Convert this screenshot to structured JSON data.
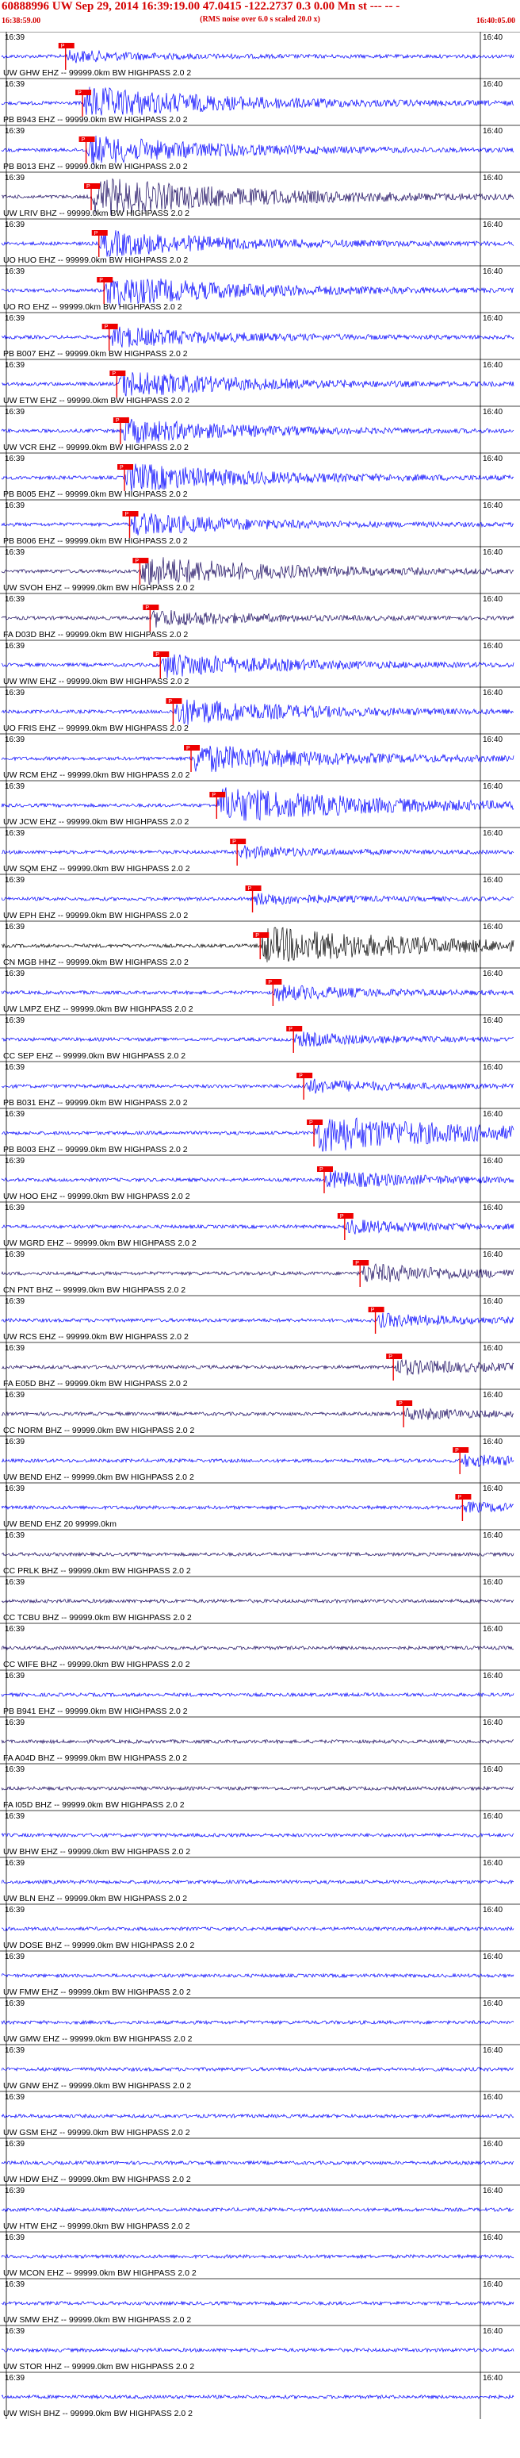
{
  "header": {
    "title": "60888996 UW Sep 29, 2014 16:39:19.00   47.0415 -122.2737  0.3 0.00 Mn st --- -- -",
    "subtitle": "(RMS noise over 6.0 s scaled 20.0 x)",
    "start_time": "16:38:59.00",
    "end_time": "16:40:05.00"
  },
  "colors": {
    "header_red": "#d40000",
    "trace_blue": "#0000ff",
    "trace_dark": "#1a0a60",
    "trace_black": "#000000",
    "pick_red": "#ee0000",
    "pick_label": "P"
  },
  "chart_data": {
    "type": "seismogram",
    "time_start": "16:38:59.00",
    "time_end": "16:40:05.00",
    "tick_left": "16:39",
    "tick_right": "16:40",
    "channels": [
      {
        "label": "UW GHW EHZ -- 99999.0km BW  HIGHPASS  2.0  2",
        "color": "blue",
        "pick": 0.125,
        "amp": 0.3
      },
      {
        "label": "PB B943 EHZ -- 99999.0km BW  HIGHPASS  2.0  2",
        "color": "blue",
        "pick": 0.158,
        "amp": 0.85
      },
      {
        "label": "PB B013 EHZ -- 99999.0km BW  HIGHPASS  2.0  2",
        "color": "blue",
        "pick": 0.165,
        "amp": 0.75
      },
      {
        "label": "UW LRIV BHZ -- 99999.0km BW  HIGHPASS  2.0  2",
        "color": "dark",
        "pick": 0.175,
        "amp": 1.0
      },
      {
        "label": "UO HUO EHZ -- 99999.0km BW  HIGHPASS  2.0  2",
        "color": "blue",
        "pick": 0.19,
        "amp": 0.7
      },
      {
        "label": "UO RO EHZ -- 99999.0km BW  HIGHPASS  2.0  2",
        "color": "blue",
        "pick": 0.2,
        "amp": 0.8
      },
      {
        "label": "PB B007 EHZ -- 99999.0km BW  HIGHPASS  2.0  2",
        "color": "blue",
        "pick": 0.21,
        "amp": 0.55
      },
      {
        "label": "UW ETW EHZ -- 99999.0km BW  HIGHPASS  2.0  2",
        "color": "blue",
        "pick": 0.225,
        "amp": 0.7
      },
      {
        "label": "UW VCR EHZ -- 99999.0km BW  HIGHPASS  2.0  2",
        "color": "blue",
        "pick": 0.232,
        "amp": 0.65
      },
      {
        "label": "PB B005 EHZ -- 99999.0km BW  HIGHPASS  2.0  2",
        "color": "blue",
        "pick": 0.24,
        "amp": 0.75
      },
      {
        "label": "PB B006 EHZ -- 99999.0km BW  HIGHPASS  2.0  2",
        "color": "blue",
        "pick": 0.25,
        "amp": 0.6
      },
      {
        "label": "UW SVOH EHZ -- 99999.0km BW  HIGHPASS  2.0  2",
        "color": "dark",
        "pick": 0.27,
        "amp": 0.8
      },
      {
        "label": "FA D03D BHZ -- 99999.0km BW  HIGHPASS  2.0  2",
        "color": "dark",
        "pick": 0.29,
        "amp": 0.45
      },
      {
        "label": "UW WIW EHZ -- 99999.0km BW  HIGHPASS  2.0  2",
        "color": "blue",
        "pick": 0.31,
        "amp": 0.65
      },
      {
        "label": "UO FRIS EHZ -- 99999.0km BW  HIGHPASS  2.0  2",
        "color": "blue",
        "pick": 0.335,
        "amp": 0.7
      },
      {
        "label": "UW RCM EHZ -- 99999.0km BW  HIGHPASS  2.0  2",
        "color": "blue",
        "pick": 0.37,
        "amp": 0.75
      },
      {
        "label": "UW JCW EHZ -- 99999.0km BW  HIGHPASS  2.0  2",
        "color": "blue",
        "pick": 0.42,
        "amp": 0.95
      },
      {
        "label": "UW SQM EHZ -- 99999.0km BW  HIGHPASS  2.0  2",
        "color": "blue",
        "pick": 0.46,
        "amp": 0.3
      },
      {
        "label": "UW EPH EHZ -- 99999.0km BW  HIGHPASS  2.0  2",
        "color": "blue",
        "pick": 0.49,
        "amp": 0.3
      },
      {
        "label": "CN MGB HHZ -- 99999.0km BW  HIGHPASS  2.0  2",
        "color": "black",
        "pick": 0.505,
        "amp": 1.0
      },
      {
        "label": "UW LMPZ EHZ -- 99999.0km BW  HIGHPASS  2.0  2",
        "color": "blue",
        "pick": 0.53,
        "amp": 0.4
      },
      {
        "label": "CC SEP EHZ -- 99999.0km BW  HIGHPASS  2.0  2",
        "color": "blue",
        "pick": 0.57,
        "amp": 0.35
      },
      {
        "label": "PB B031 EHZ -- 99999.0km BW  HIGHPASS  2.0  2",
        "color": "blue",
        "pick": 0.59,
        "amp": 0.35
      },
      {
        "label": "PB B003 EHZ -- 99999.0km BW  HIGHPASS  2.0  2",
        "color": "blue",
        "pick": 0.61,
        "amp": 1.0
      },
      {
        "label": "UW HOO EHZ -- 99999.0km BW  HIGHPASS  2.0  2",
        "color": "blue",
        "pick": 0.63,
        "amp": 0.45
      },
      {
        "label": "UW MGRD EHZ -- 99999.0km BW  HIGHPASS  2.0  2",
        "color": "blue",
        "pick": 0.67,
        "amp": 0.35
      },
      {
        "label": "CN PNT BHZ -- 99999.0km BW  HIGHPASS  2.0  2",
        "color": "dark",
        "pick": 0.7,
        "amp": 0.5
      },
      {
        "label": "UW RCS EHZ -- 99999.0km BW  HIGHPASS  2.0  2",
        "color": "blue",
        "pick": 0.73,
        "amp": 0.35
      },
      {
        "label": "FA E05D BHZ -- 99999.0km BW  HIGHPASS  2.0  2",
        "color": "dark",
        "pick": 0.765,
        "amp": 0.4
      },
      {
        "label": "CC NORM BHZ -- 99999.0km BW  HIGHPASS  2.0  2",
        "color": "dark",
        "pick": 0.785,
        "amp": 0.3
      },
      {
        "label": "UW BEND EHZ -- 99999.0km BW  HIGHPASS  2.0  2",
        "color": "blue",
        "pick": 0.895,
        "amp": 0.3
      },
      {
        "label": "UW BEND EHZ 20 99999.0km",
        "color": "blue",
        "pick": 0.9,
        "amp": 0.25
      },
      {
        "label": "CC PRLK BHZ -- 99999.0km BW  HIGHPASS  2.0  2",
        "color": "dark",
        "pick": null,
        "amp": 0.3
      },
      {
        "label": "CC TCBU BHZ -- 99999.0km BW  HIGHPASS  2.0  2",
        "color": "dark",
        "pick": null,
        "amp": 0.35
      },
      {
        "label": "CC WIFE BHZ -- 99999.0km BW  HIGHPASS  2.0  2",
        "color": "dark",
        "pick": null,
        "amp": 0.3
      },
      {
        "label": "PB B941 EHZ -- 99999.0km BW  HIGHPASS  2.0  2",
        "color": "blue",
        "pick": null,
        "amp": 0.35
      },
      {
        "label": "FA A04D BHZ -- 99999.0km BW  HIGHPASS  2.0  2",
        "color": "dark",
        "pick": null,
        "amp": 0.4
      },
      {
        "label": "FA I05D BHZ -- 99999.0km BW  HIGHPASS  2.0  2",
        "color": "dark",
        "pick": null,
        "amp": 0.35
      },
      {
        "label": "UW BHW EHZ -- 99999.0km BW  HIGHPASS  2.0  2",
        "color": "blue",
        "pick": null,
        "amp": 0.35
      },
      {
        "label": "UW BLN EHZ -- 99999.0km BW  HIGHPASS  2.0  2",
        "color": "blue",
        "pick": null,
        "amp": 0.4
      },
      {
        "label": "UW DOSE BHZ -- 99999.0km BW  HIGHPASS  2.0  2",
        "color": "blue",
        "pick": null,
        "amp": 0.4
      },
      {
        "label": "UW FMW EHZ -- 99999.0km BW  HIGHPASS  2.0  2",
        "color": "blue",
        "pick": null,
        "amp": 0.4
      },
      {
        "label": "UW GMW EHZ -- 99999.0km BW  HIGHPASS  2.0  2",
        "color": "blue",
        "pick": null,
        "amp": 0.4
      },
      {
        "label": "UW GNW EHZ -- 99999.0km BW  HIGHPASS  2.0  2",
        "color": "blue",
        "pick": null,
        "amp": 0.4
      },
      {
        "label": "UW GSM EHZ -- 99999.0km BW  HIGHPASS  2.0  2",
        "color": "blue",
        "pick": null,
        "amp": 0.4
      },
      {
        "label": "UW HDW EHZ -- 99999.0km BW  HIGHPASS  2.0  2",
        "color": "blue",
        "pick": null,
        "amp": 0.4
      },
      {
        "label": "UW HTW EHZ -- 99999.0km BW  HIGHPASS  2.0  2",
        "color": "blue",
        "pick": null,
        "amp": 0.4
      },
      {
        "label": "UW MCON EHZ -- 99999.0km BW  HIGHPASS  2.0  2",
        "color": "blue",
        "pick": null,
        "amp": 0.4
      },
      {
        "label": "UW SMW EHZ -- 99999.0km BW  HIGHPASS  2.0  2",
        "color": "blue",
        "pick": null,
        "amp": 0.4
      },
      {
        "label": "UW STOR HHZ -- 99999.0km BW  HIGHPASS  2.0  2",
        "color": "blue",
        "pick": null,
        "amp": 0.4
      },
      {
        "label": "UW WISH BHZ -- 99999.0km BW  HIGHPASS  2.0  2",
        "color": "blue",
        "pick": null,
        "amp": 0.4
      }
    ]
  }
}
